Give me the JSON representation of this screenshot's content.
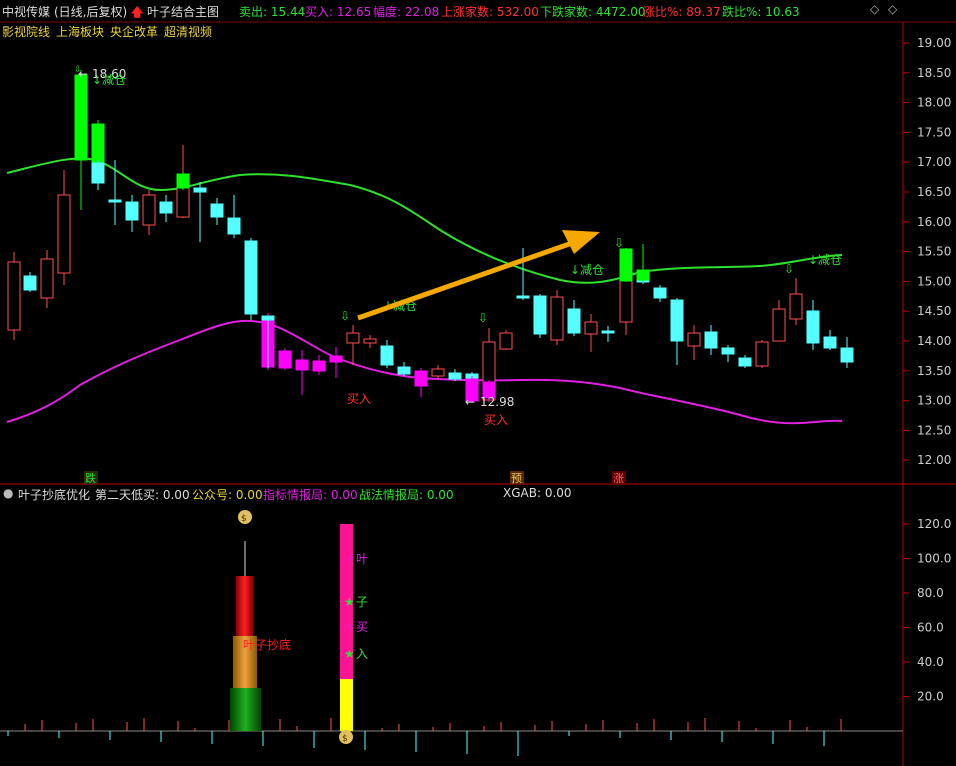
{
  "header": {
    "stock_name": "中视传媒",
    "period": "(日线,后复权)",
    "indicator": "叶子结合主图",
    "sell_label": "卖出: 15.44",
    "buy_label": "买入: 12.65",
    "amplitude_label": "幅度: 22.08",
    "up_count_label": "上涨家数: 532.00",
    "down_count_label": "下跌家数: 4472.00",
    "up_ratio_label": "涨比%: 89.37",
    "down_ratio_label": "跌比%: 10.63"
  },
  "sectors": [
    "影视院线",
    "上海板块",
    "央企改革",
    "超清视频"
  ],
  "main_chart": {
    "price_axis": [
      "19.00",
      "18.50",
      "18.00",
      "17.50",
      "17.00",
      "16.50",
      "16.00",
      "15.50",
      "15.00",
      "14.50",
      "14.00",
      "13.50",
      "13.00",
      "12.50",
      "12.00"
    ],
    "high_label": "18.60",
    "low_label": "12.98",
    "reduce_label": "↓减仓",
    "buy_label": "买入",
    "markers": {
      "fall": "跌",
      "pre": "预",
      "rise": "涨"
    }
  },
  "sub_header": {
    "name": "叶子抄底优化",
    "next_day": "第二天低买: 0.00",
    "public": "公众号: 0.00",
    "indicator_info": "指标情报局: 0.00",
    "strategy_info": "战法情报局: 0.00",
    "xgab": "XGAB: 0.00"
  },
  "sub_chart": {
    "axis": [
      "120.0",
      "100.0",
      "80.0",
      "60.0",
      "40.0",
      "20.0"
    ],
    "bottom_label": "叶子抄底",
    "star_labels": [
      "叶",
      "子",
      "买",
      "入"
    ]
  },
  "colors": {
    "up": "#ff5050",
    "down": "#54ffff",
    "highlight_up": "#00ff00",
    "highlight_down": "#ff00ff",
    "ma_green": "#2fe02f",
    "ma_magenta": "#e020e0",
    "arrow": "#f5a800",
    "border": "#c00000"
  }
}
